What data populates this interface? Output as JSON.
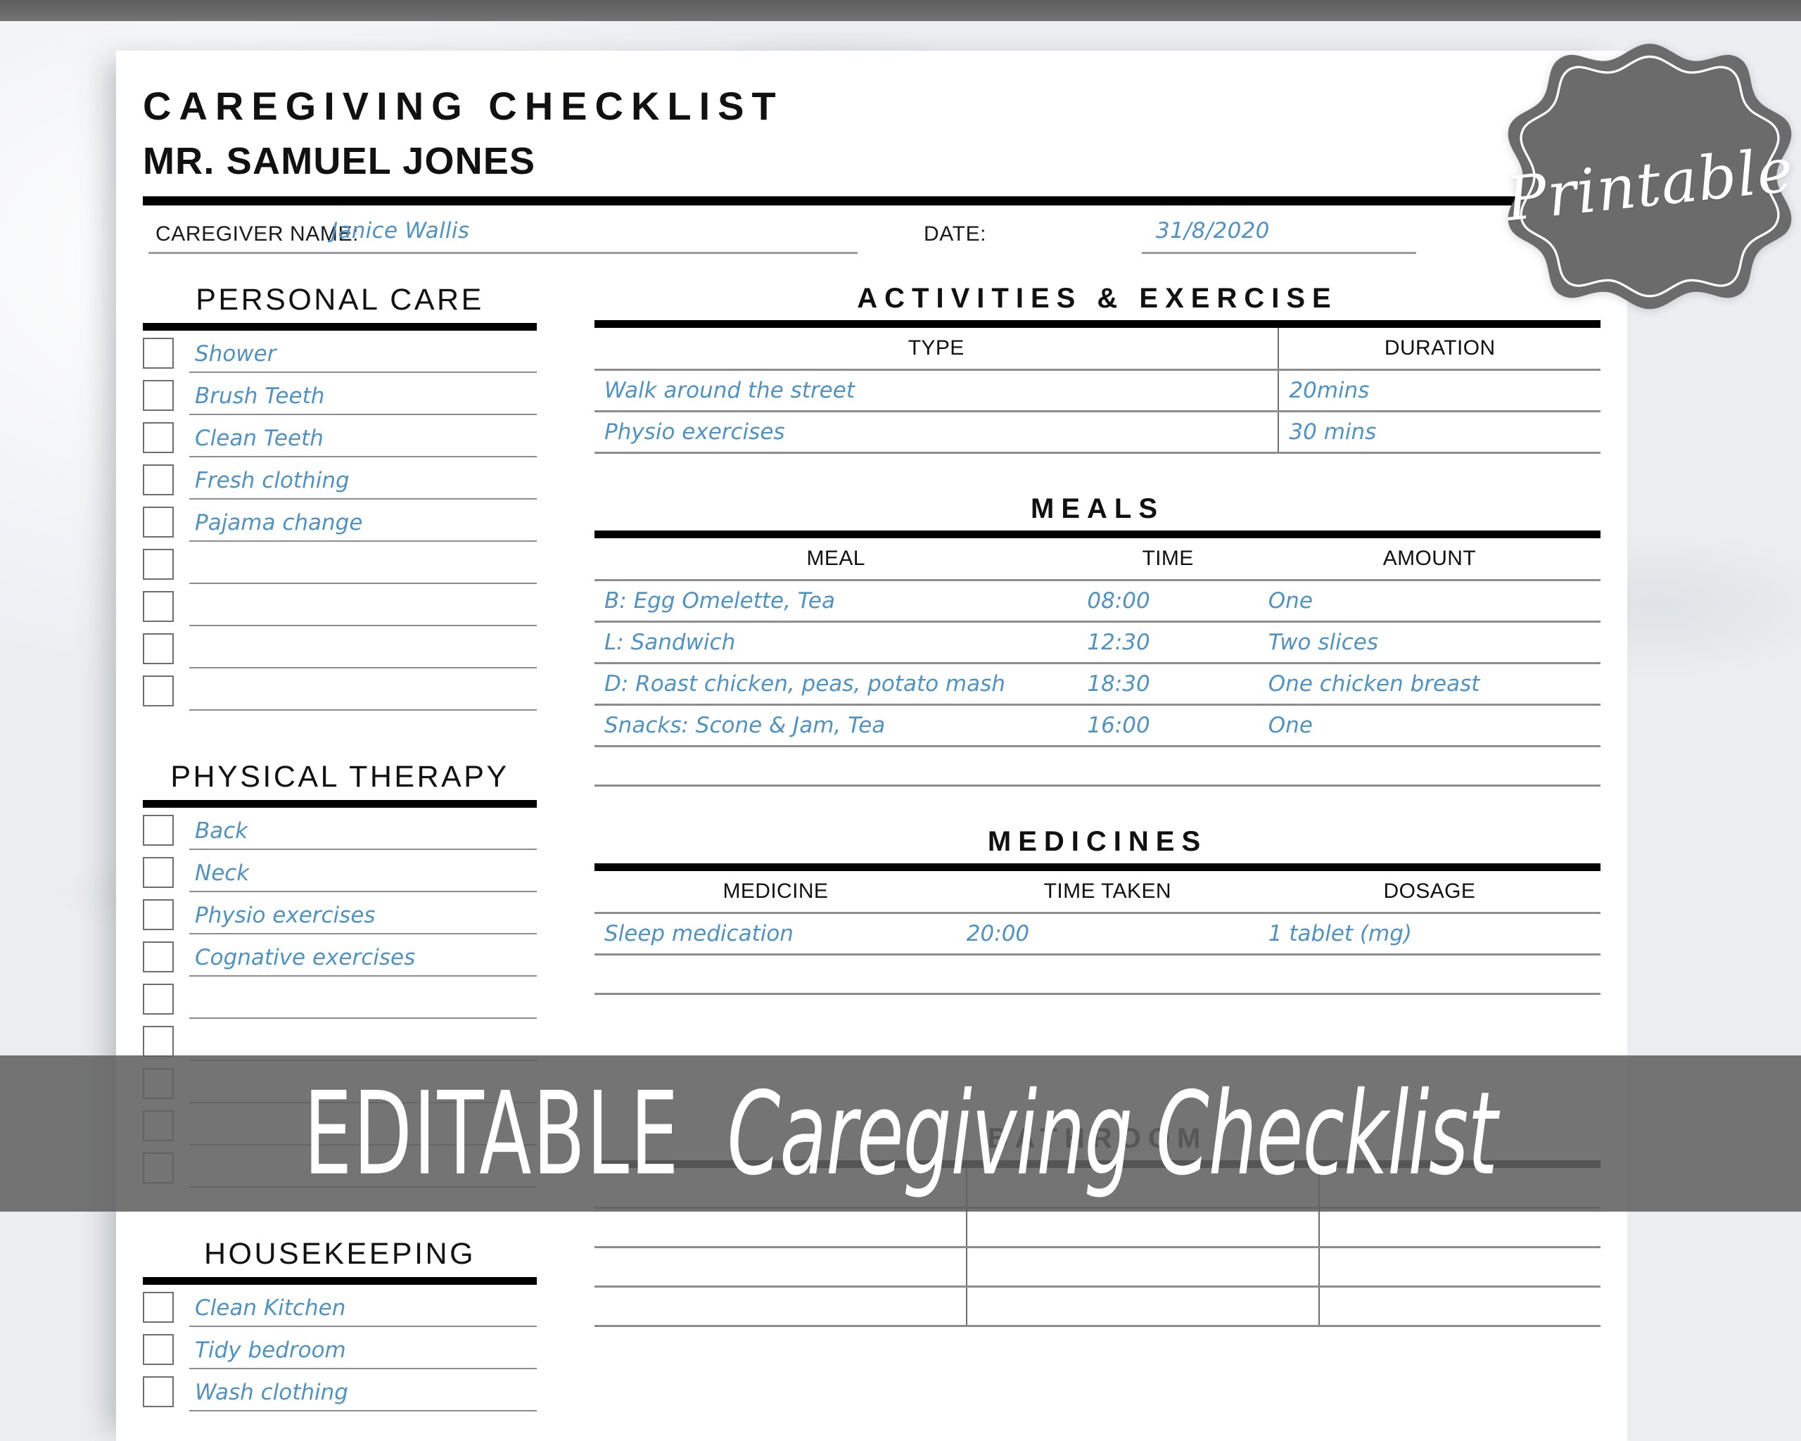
{
  "badge": {
    "label": "Printable"
  },
  "banner": {
    "bold_part": "EDITABLE",
    "script_part": "Caregiving Checklist"
  },
  "header": {
    "title": "CAREGIVING CHECKLIST",
    "subtitle": "MR. SAMUEL JONES"
  },
  "meta": {
    "caregiver_label": "CAREGIVER NAME:",
    "caregiver_value": "Janice Wallis",
    "date_label": "DATE:",
    "date_value": "31/8/2020"
  },
  "personal_care": {
    "title": "PERSONAL CARE",
    "items": [
      "Shower",
      "Brush Teeth",
      "Clean Teeth",
      "Fresh clothing",
      "Pajama change",
      "",
      "",
      "",
      ""
    ]
  },
  "physical_therapy": {
    "title": "PHYSICAL THERAPY",
    "items": [
      "Back",
      "Neck",
      "Physio exercises",
      "Cognative exercises",
      "",
      "",
      "",
      "",
      ""
    ]
  },
  "housekeeping": {
    "title": "HOUSEKEEPING",
    "items": [
      "Clean Kitchen",
      "Tidy bedroom",
      "Wash clothing"
    ]
  },
  "activities": {
    "title": "ACTIVITIES & EXERCISE",
    "columns": [
      "TYPE",
      "DURATION"
    ],
    "rows": [
      [
        "Walk around the street",
        "20mins"
      ],
      [
        "Physio exercises",
        "30 mins"
      ]
    ]
  },
  "meals": {
    "title": "MEALS",
    "columns": [
      "MEAL",
      "TIME",
      "AMOUNT"
    ],
    "rows": [
      [
        "B: Egg Omelette, Tea",
        "08:00",
        "One"
      ],
      [
        "L: Sandwich",
        "12:30",
        "Two slices"
      ],
      [
        "D: Roast chicken, peas, potato mash",
        "18:30",
        "One chicken breast"
      ],
      [
        "Snacks: Scone & Jam, Tea",
        "16:00",
        "One"
      ],
      [
        "",
        "",
        ""
      ]
    ]
  },
  "medicines": {
    "title": "MEDICINES",
    "columns": [
      "MEDICINE",
      "TIME TAKEN",
      "DOSAGE"
    ],
    "rows": [
      [
        "Sleep medication",
        "20:00",
        "1 tablet (mg)"
      ],
      [
        "",
        "",
        ""
      ]
    ]
  },
  "bathroom": {
    "title": "BATHROOM",
    "columns": [
      "",
      "",
      ""
    ],
    "rows": [
      [
        "",
        "",
        ""
      ],
      [
        "",
        "",
        ""
      ],
      [
        "",
        "",
        ""
      ],
      [
        "",
        "",
        ""
      ]
    ]
  },
  "colors": {
    "handwriting_blue": "#4f93c4",
    "rule_black": "#000000",
    "line_gray": "#8d8d8d",
    "banner_gray": "#616161",
    "badge_gray": "#6b6b6b"
  }
}
